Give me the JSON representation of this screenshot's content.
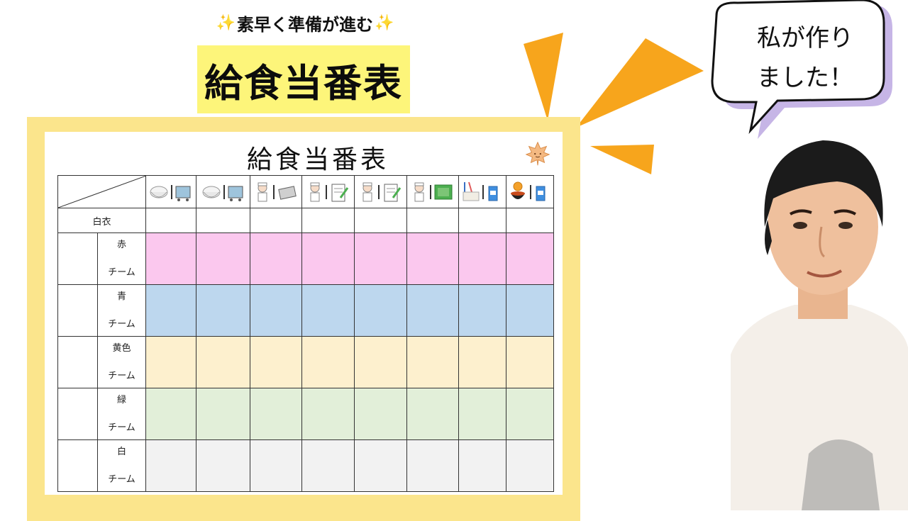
{
  "header": {
    "subtitle": "素早く準備が進む",
    "title": "給食当番表"
  },
  "sheet": {
    "title": "給食当番表",
    "row_hakui": "白衣",
    "teams": [
      {
        "line1": "赤",
        "line2": "チーム",
        "color": "#fbc8ee"
      },
      {
        "line1": "青",
        "line2": "チーム",
        "color": "#bdd7ee"
      },
      {
        "line1": "黄色",
        "line2": "チーム",
        "color": "#fdf0ce"
      },
      {
        "line1": "緑",
        "line2": "チーム",
        "color": "#e2efd9"
      },
      {
        "line1": "白",
        "line2": "チーム",
        "color": "#f2f2f2"
      }
    ],
    "duty_icons": [
      "rice-bowl-and-cart-icon",
      "rice-bowl-and-cart-icon",
      "worker-and-tray-icon",
      "worker-and-clipboard-icon",
      "worker-and-clipboard-icon",
      "worker-and-green-board-icon",
      "utensils-and-milk-icon",
      "soup-and-milk-icon"
    ]
  },
  "speech_bubble": {
    "line1": "私が作り",
    "line2": "ました！"
  },
  "colors": {
    "accent_orange": "#f7a51c",
    "frame_yellow": "#fbe58c",
    "title_highlight": "#fdf57a",
    "bubble_shadow": "#c6b5e6"
  }
}
